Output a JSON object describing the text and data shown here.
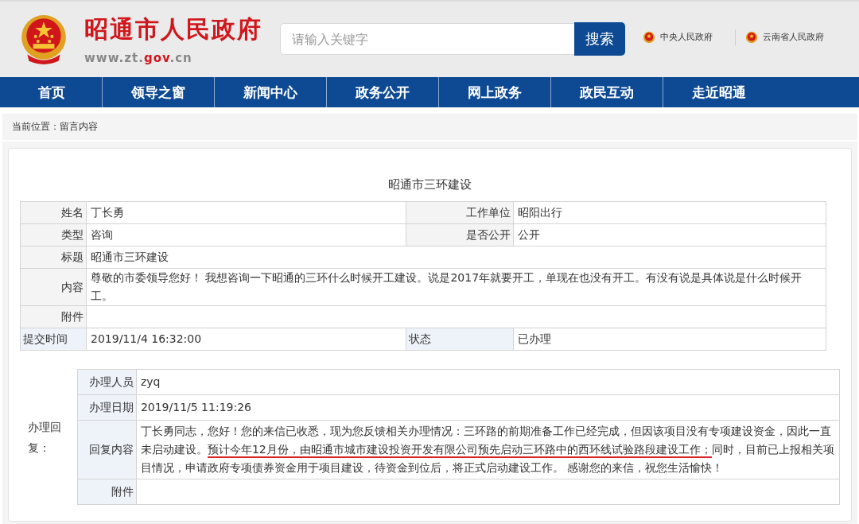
{
  "header": {
    "site_title": "昭通市人民政府",
    "site_url_parts": [
      {
        "text": "www.zt.",
        "accent": false
      },
      {
        "text": "gov",
        "accent": true
      },
      {
        "text": ".cn",
        "accent": false
      }
    ],
    "search": {
      "placeholder": "请输入关键字",
      "button": "搜索"
    },
    "links": [
      "中央人民政府",
      "云南省人民政府"
    ]
  },
  "nav": [
    "首页",
    "领导之窗",
    "新闻中心",
    "政务公开",
    "网上政务",
    "政民互动",
    "走近昭通"
  ],
  "breadcrumb": "当前位置：留言内容",
  "message": {
    "title": "昭通市三环建设",
    "rows": [
      {
        "kind": "pair",
        "label": "姓名",
        "value": "丁长勇",
        "label_2": "工作单位",
        "value_2": "昭阳出行"
      },
      {
        "kind": "pair",
        "label": "类型",
        "value": "咨询",
        "label_2": "是否公开",
        "value_2": "公开"
      },
      {
        "kind": "wide",
        "label": "标题",
        "value": "昭通市三环建设"
      },
      {
        "kind": "wide",
        "label": "内容",
        "value": "尊敬的市委领导您好！ 我想咨询一下昭通的三环什么时候开工建设。说是2017年就要开工，单现在也没有开工。有没有说是具体说是什么时候开工。"
      },
      {
        "kind": "wide",
        "label": "附件"
      },
      {
        "kind": "status",
        "label": "提交时间",
        "value": "2019/11/4 16:32:00",
        "label_2": "状态",
        "value_2": "已办理"
      }
    ]
  },
  "reply": {
    "label": "办理回复：",
    "rows": [
      {
        "label": "办理人员",
        "value": "zyq"
      },
      {
        "label": "办理日期",
        "value": "2019/11/5 11:19:26"
      },
      {
        "label": "回复内容",
        "segments": [
          {
            "text": "丁长勇同志，您好！您的来信已收悉，现为您反馈相关办理情况：三环路的前期准备工作已经完成，但因该项目没有专项建设资金，因此一直未启动建设。",
            "underlined": false
          },
          {
            "text": "预计今年12月份，由昭通市城市建设投资开发有限公司预先启动三环路中的西环线试验路段建设工作；",
            "underlined": true
          },
          {
            "text": "同时，目前已上报相关项目情况，申请政府专项债券资金用于项目建设，待资金到位后，将正式启动建设工作。 感谢您的来信，祝您生活愉快！",
            "underlined": false
          }
        ]
      },
      {
        "label": "附件"
      }
    ]
  }
}
